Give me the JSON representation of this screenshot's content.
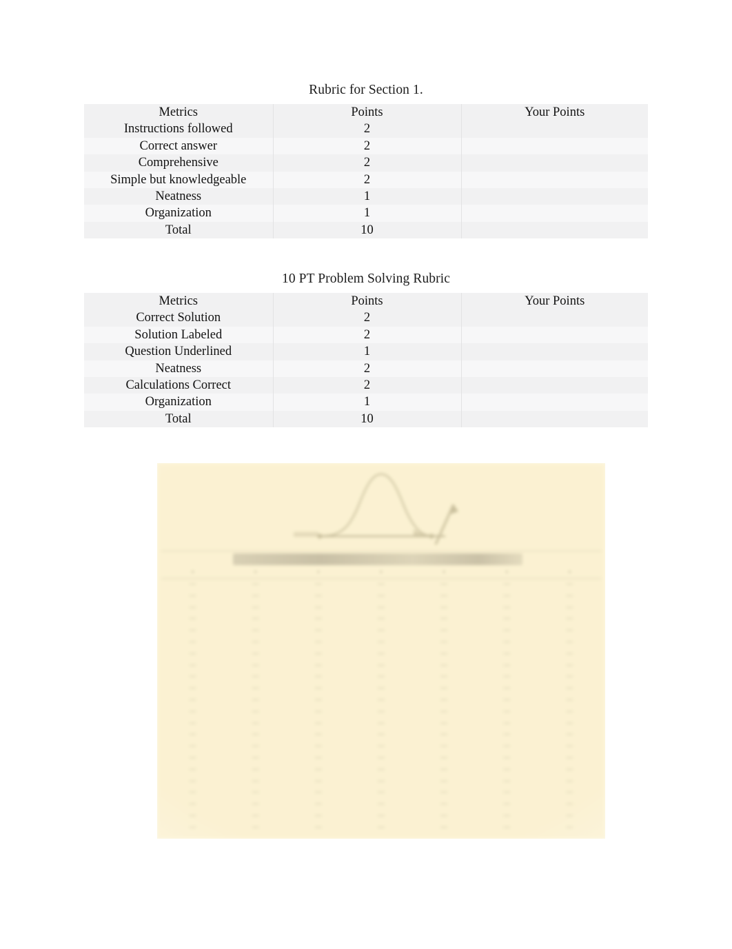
{
  "document": {
    "page_background": "#ffffff",
    "text_color": "#121212"
  },
  "section_1": {
    "title": "Rubric for Section 1.",
    "table": {
      "columns": [
        "Metrics",
        "Points",
        "Your Points"
      ],
      "rows": [
        {
          "metric": "Instructions followed",
          "points": "2",
          "your_points": ""
        },
        {
          "metric": "Correct answer",
          "points": "2",
          "your_points": ""
        },
        {
          "metric": "Comprehensive",
          "points": "2",
          "your_points": ""
        },
        {
          "metric": "Simple but knowledgeable",
          "points": "2",
          "your_points": ""
        },
        {
          "metric": "Neatness",
          "points": "1",
          "your_points": ""
        },
        {
          "metric": "Organization",
          "points": "1",
          "your_points": ""
        },
        {
          "metric": "Total",
          "points": "10",
          "your_points": ""
        }
      ]
    }
  },
  "section_2": {
    "title": "10 PT Problem Solving Rubric",
    "table": {
      "columns": [
        "Metrics",
        "Points",
        "Your Points"
      ],
      "rows": [
        {
          "metric": "Correct Solution",
          "points": "2",
          "your_points": ""
        },
        {
          "metric": "Solution Labeled",
          "points": "2",
          "your_points": ""
        },
        {
          "metric": "Question Underlined",
          "points": "1",
          "your_points": ""
        },
        {
          "metric": "Neatness",
          "points": "2",
          "your_points": ""
        },
        {
          "metric": "Calculations Correct",
          "points": "2",
          "your_points": ""
        },
        {
          "metric": "Organization",
          "points": "1",
          "your_points": ""
        },
        {
          "metric": "Total",
          "points": "10",
          "your_points": ""
        }
      ]
    }
  },
  "scanned_figure": {
    "description": "faded scanned statistical distribution table with bell curve",
    "background_color": "#faeec6",
    "ink_color": "#7a6e50",
    "caption": "",
    "curve_label": "",
    "columns": [
      {
        "header": "",
        "values": [
          "",
          "",
          "",
          "",
          "",
          "",
          "",
          "",
          "",
          "",
          "",
          "",
          "",
          "",
          "",
          "",
          "",
          "",
          "",
          "",
          "",
          ""
        ]
      },
      {
        "header": "",
        "values": [
          "",
          "",
          "",
          "",
          "",
          "",
          "",
          "",
          "",
          "",
          "",
          "",
          "",
          "",
          "",
          "",
          "",
          "",
          "",
          "",
          "",
          ""
        ]
      },
      {
        "header": "",
        "values": [
          "",
          "",
          "",
          "",
          "",
          "",
          "",
          "",
          "",
          "",
          "",
          "",
          "",
          "",
          "",
          "",
          "",
          "",
          "",
          "",
          "",
          ""
        ]
      },
      {
        "header": "",
        "values": [
          "",
          "",
          "",
          "",
          "",
          "",
          "",
          "",
          "",
          "",
          "",
          "",
          "",
          "",
          "",
          "",
          "",
          "",
          "",
          "",
          "",
          ""
        ]
      },
      {
        "header": "",
        "values": [
          "",
          "",
          "",
          "",
          "",
          "",
          "",
          "",
          "",
          "",
          "",
          "",
          "",
          "",
          "",
          "",
          "",
          "",
          "",
          "",
          "",
          ""
        ]
      },
      {
        "header": "",
        "values": [
          "",
          "",
          "",
          "",
          "",
          "",
          "",
          "",
          "",
          "",
          "",
          "",
          "",
          "",
          "",
          "",
          "",
          "",
          "",
          "",
          "",
          ""
        ]
      },
      {
        "header": "",
        "values": [
          "",
          "",
          "",
          "",
          "",
          "",
          "",
          "",
          "",
          "",
          "",
          "",
          "",
          "",
          "",
          "",
          "",
          "",
          "",
          "",
          "",
          ""
        ]
      }
    ]
  }
}
